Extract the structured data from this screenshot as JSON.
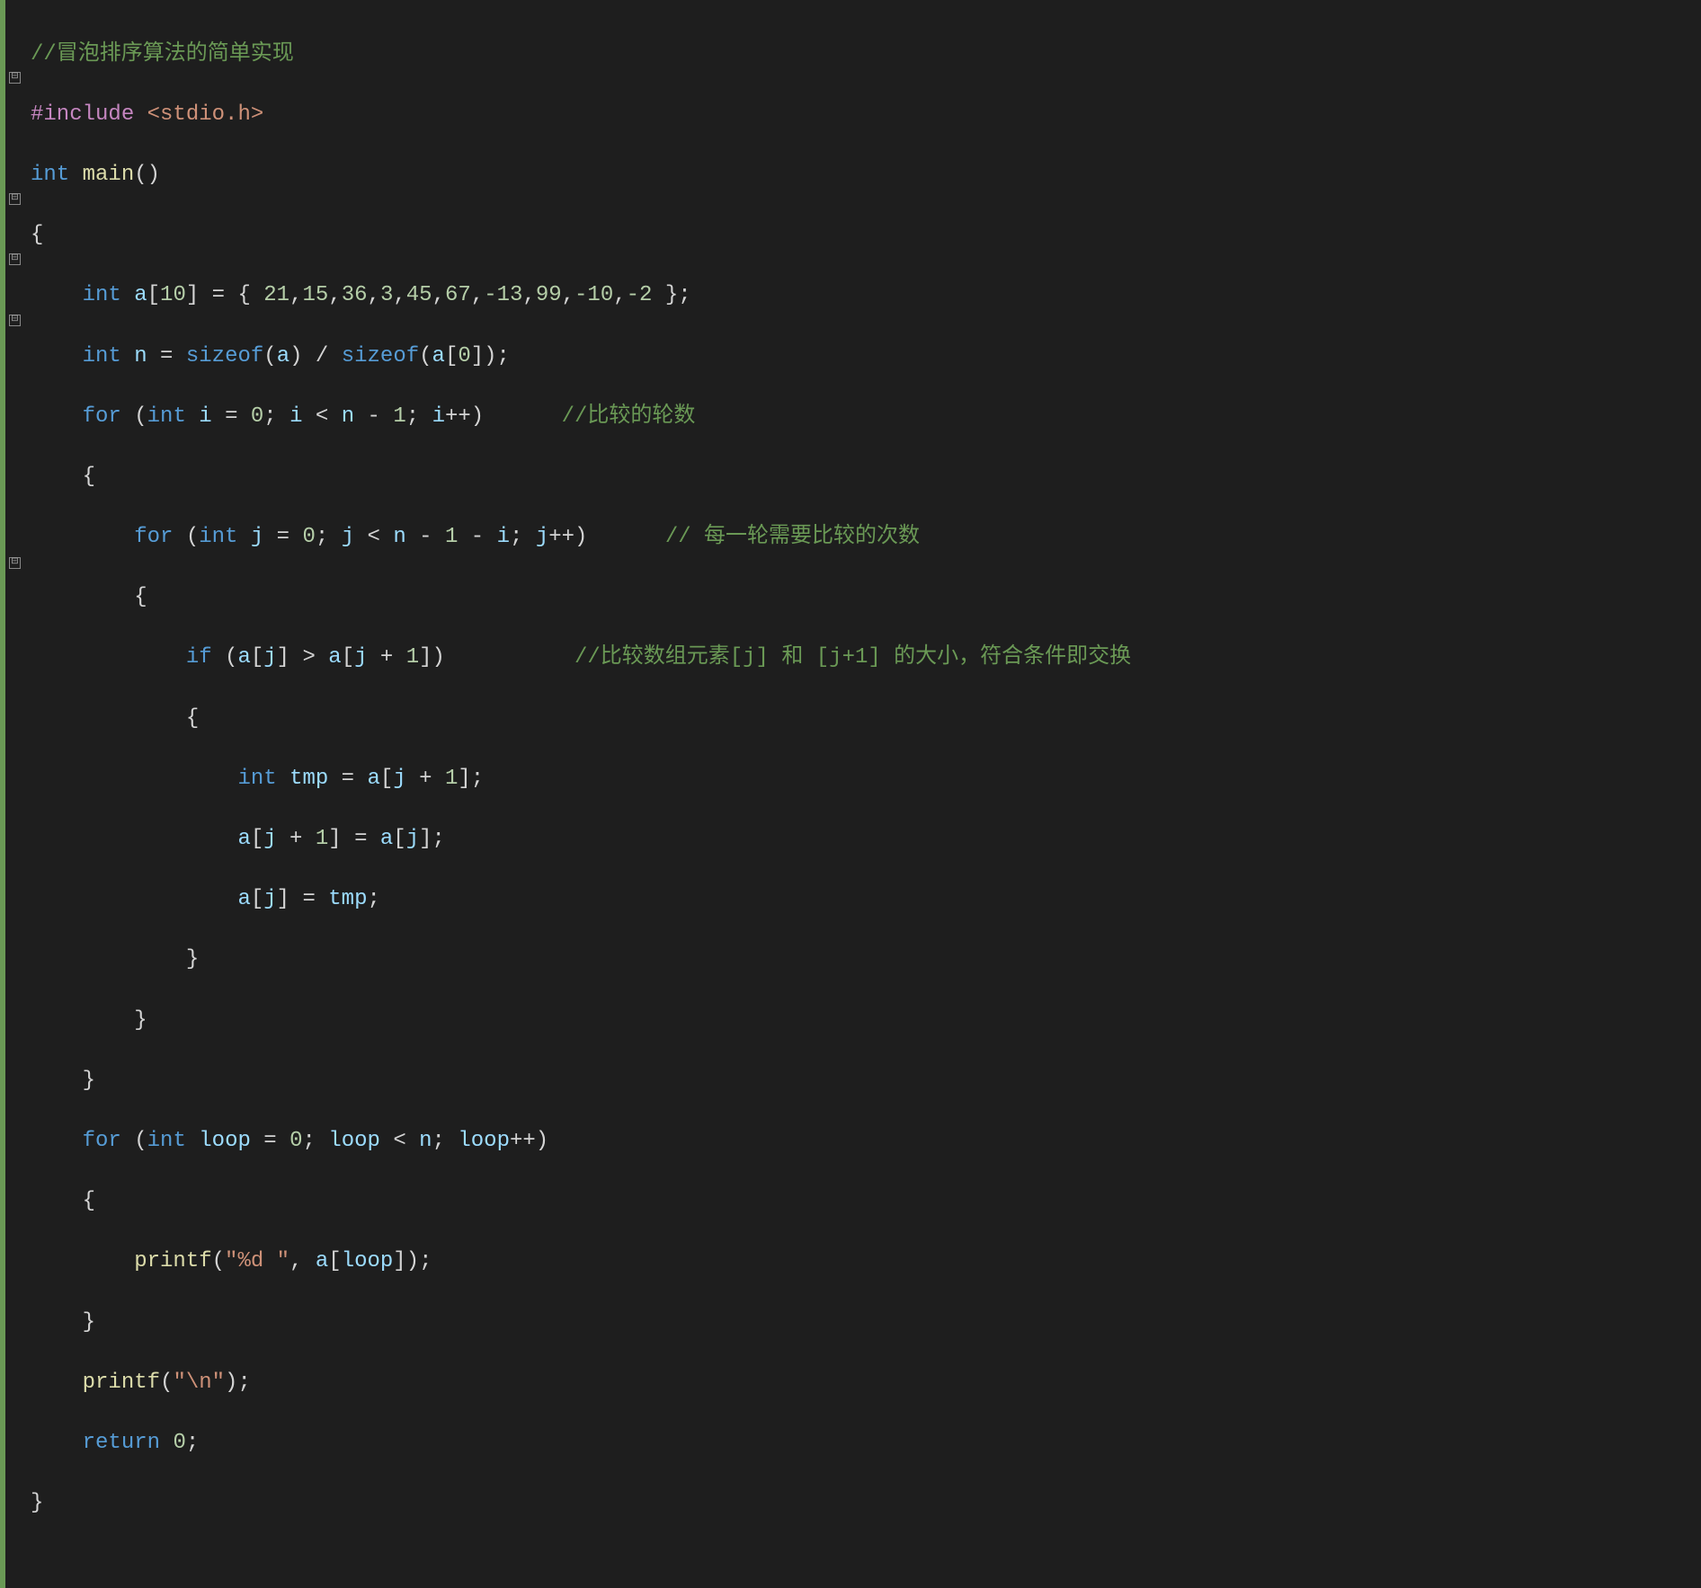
{
  "code": {
    "l1": "//冒泡排序算法的简单实现",
    "l2_a": "#include",
    "l2_b": "<stdio.h>",
    "l3_a": "int",
    "l3_b": "main",
    "l3_c": "()",
    "l4": "{",
    "l5_a": "int",
    "l5_b": "a",
    "l5_c": "[",
    "l5_d": "10",
    "l5_e": "] = { ",
    "l5_f": "21",
    "l5_g": ",",
    "l5_h": "15",
    "l5_i": ",",
    "l5_j": "36",
    "l5_k": ",",
    "l5_l": "3",
    "l5_m": ",",
    "l5_n": "45",
    "l5_o": ",",
    "l5_p": "67",
    "l5_q": ",",
    "l5_r": "-13",
    "l5_s": ",",
    "l5_t": "99",
    "l5_u": ",",
    "l5_v": "-10",
    "l5_w": ",",
    "l5_x": "-2",
    "l5_y": " };",
    "l6_a": "int",
    "l6_b": "n",
    "l6_c": " = ",
    "l6_d": "sizeof",
    "l6_e": "(",
    "l6_f": "a",
    "l6_g": ") / ",
    "l6_h": "sizeof",
    "l6_i": "(",
    "l6_j": "a",
    "l6_k": "[",
    "l6_l": "0",
    "l6_m": "]);",
    "l7_a": "for",
    "l7_b": " (",
    "l7_c": "int",
    "l7_d": "i",
    "l7_e": " = ",
    "l7_f": "0",
    "l7_g": "; ",
    "l7_h": "i",
    "l7_i": " < ",
    "l7_j": "n",
    "l7_k": " - ",
    "l7_l": "1",
    "l7_m": "; ",
    "l7_n": "i",
    "l7_o": "++)      ",
    "l7_p": "//比较的轮数",
    "l8": "{",
    "l9_a": "for",
    "l9_b": " (",
    "l9_c": "int",
    "l9_d": "j",
    "l9_e": " = ",
    "l9_f": "0",
    "l9_g": "; ",
    "l9_h": "j",
    "l9_i": " < ",
    "l9_j": "n",
    "l9_k": " - ",
    "l9_l": "1",
    "l9_m": " - ",
    "l9_n": "i",
    "l9_o": "; ",
    "l9_p": "j",
    "l9_q": "++)      ",
    "l9_r": "// 每一轮需要比较的次数",
    "l10": "{",
    "l11_a": "if",
    "l11_b": " (",
    "l11_c": "a",
    "l11_d": "[",
    "l11_e": "j",
    "l11_f": "] > ",
    "l11_g": "a",
    "l11_h": "[",
    "l11_i": "j",
    "l11_j": " + ",
    "l11_k": "1",
    "l11_l": "])          ",
    "l11_m": "//比较数组元素[j] 和 [j+1] 的大小，符合条件即交换",
    "l12": "{",
    "l13_a": "int",
    "l13_b": "tmp",
    "l13_c": " = ",
    "l13_d": "a",
    "l13_e": "[",
    "l13_f": "j",
    "l13_g": " + ",
    "l13_h": "1",
    "l13_i": "];",
    "l14_a": "a",
    "l14_b": "[",
    "l14_c": "j",
    "l14_d": " + ",
    "l14_e": "1",
    "l14_f": "] = ",
    "l14_g": "a",
    "l14_h": "[",
    "l14_i": "j",
    "l14_j": "];",
    "l15_a": "a",
    "l15_b": "[",
    "l15_c": "j",
    "l15_d": "] = ",
    "l15_e": "tmp",
    "l15_f": ";",
    "l16": "}",
    "l17": "}",
    "l18": "}",
    "l19_a": "for",
    "l19_b": " (",
    "l19_c": "int",
    "l19_d": "loop",
    "l19_e": " = ",
    "l19_f": "0",
    "l19_g": "; ",
    "l19_h": "loop",
    "l19_i": " < ",
    "l19_j": "n",
    "l19_k": "; ",
    "l19_l": "loop",
    "l19_m": "++)",
    "l20": "{",
    "l21_a": "printf",
    "l21_b": "(",
    "l21_c": "\"%d \"",
    "l21_d": ", ",
    "l21_e": "a",
    "l21_f": "[",
    "l21_g": "loop",
    "l21_h": "]);",
    "l22": "}",
    "l23_a": "printf",
    "l23_b": "(",
    "l23_c": "\"\\n\"",
    "l23_d": ");",
    "l24_a": "return",
    "l24_b": "0",
    "l24_c": ";",
    "l25": "}"
  },
  "fold_marks": {
    "mark": "⊟"
  }
}
